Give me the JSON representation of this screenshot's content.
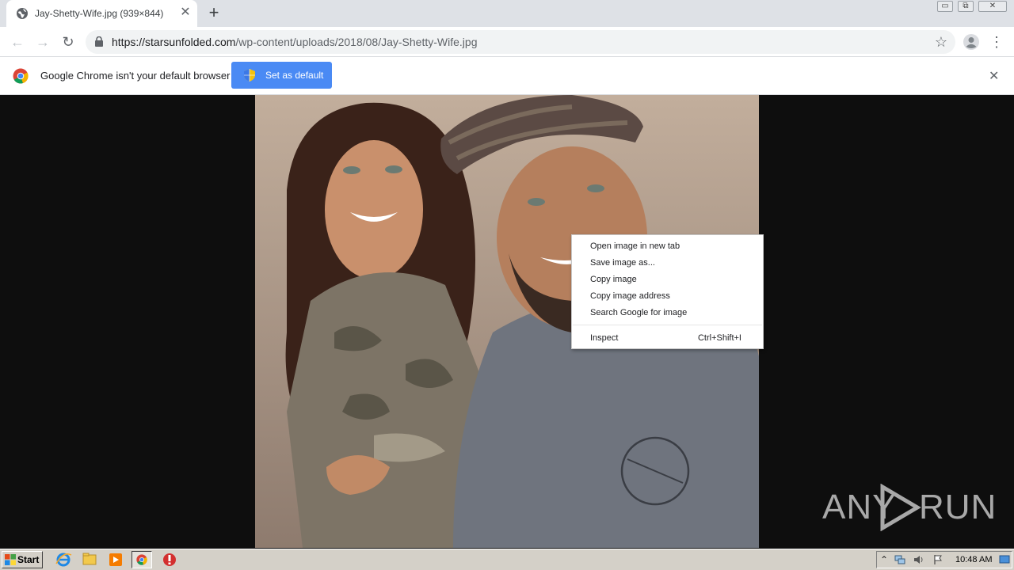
{
  "tab": {
    "title": "Jay-Shetty-Wife.jpg (939×844)",
    "close": "✕"
  },
  "new_tab": "+",
  "window": {
    "minimize": "▭",
    "restore": "⧉",
    "close": "✕"
  },
  "toolbar": {
    "back": "←",
    "forward": "→",
    "reload": "↻",
    "url_host": "https://starsunfolded.com",
    "url_path": "/wp-content/uploads/2018/08/Jay-Shetty-Wife.jpg",
    "star": "☆",
    "menu": "⋮"
  },
  "infobar": {
    "message": "Google Chrome isn't your default browser",
    "button_label": "Set as default",
    "close": "✕"
  },
  "context_menu": {
    "items": [
      {
        "label": "Open image in new tab"
      },
      {
        "label": "Save image as..."
      },
      {
        "label": "Copy image"
      },
      {
        "label": "Copy image address"
      },
      {
        "label": "Search Google for image"
      }
    ],
    "inspect": {
      "label": "Inspect",
      "shortcut": "Ctrl+Shift+I"
    }
  },
  "watermark": {
    "left": "ANY",
    "right": "RUN"
  },
  "taskbar": {
    "start_label": "Start",
    "clock": "10:48 AM",
    "tray_expand": "⌃"
  }
}
